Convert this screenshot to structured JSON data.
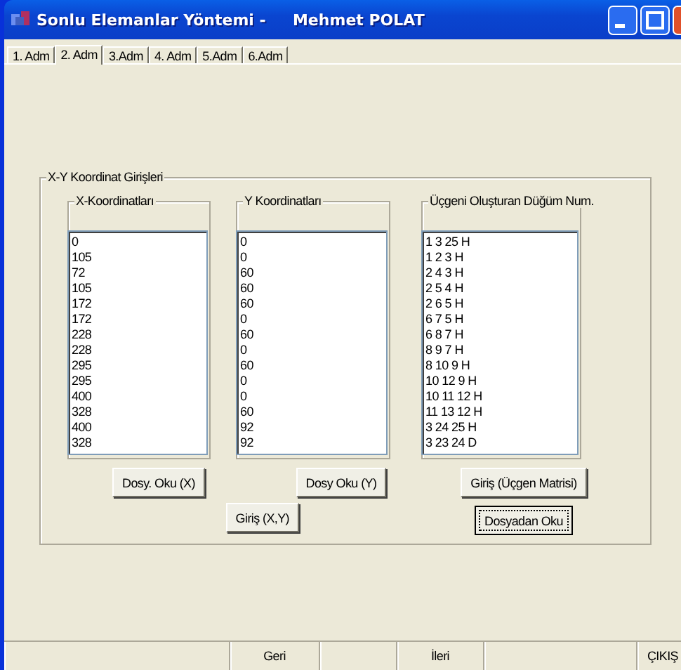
{
  "window": {
    "title": "Sonlu Elemanlar Yöntemi -     Mehmet POLAT"
  },
  "tabs": [
    {
      "label": "1. Adm",
      "selected": false
    },
    {
      "label": "2. Adm",
      "selected": true
    },
    {
      "label": "3.Adm",
      "selected": false
    },
    {
      "label": "4. Adm",
      "selected": false
    },
    {
      "label": "5.Adm",
      "selected": false
    },
    {
      "label": "6.Adm",
      "selected": false
    }
  ],
  "group": {
    "title": "X-Y Koordinat Girişleri",
    "lists": [
      {
        "title": "X-Koordinatları",
        "items": [
          "0",
          "105",
          "72",
          "105",
          "172",
          "172",
          "228",
          "228",
          "295",
          "295",
          "400",
          "328",
          "400",
          "328"
        ]
      },
      {
        "title": "Y Koordinatları",
        "items": [
          "0",
          "0",
          "60",
          "60",
          "60",
          "0",
          "60",
          "0",
          "60",
          "0",
          "0",
          "60",
          "92",
          "92"
        ]
      },
      {
        "title": "Üçgeni Oluşturan Düğüm Num.",
        "items": [
          "1 3 25 H",
          "1 2 3 H",
          "2 4 3 H",
          "2 5 4 H",
          "2 6 5 H",
          "6 7 5 H",
          "6 8 7 H",
          "8 9 7 H",
          "8 10 9 H",
          "10 12 9 H",
          "10 11 12 H",
          "11 13 12 H",
          "3 24 25 H",
          "3 23 24 D"
        ]
      }
    ],
    "buttons": [
      {
        "label": "Dosy. Oku (X)",
        "focused": false
      },
      {
        "label": "Dosy Oku (Y)",
        "focused": false
      },
      {
        "label": "Giriş (Üçgen Matrisi)",
        "focused": false
      },
      {
        "label": "Giriş (X,Y)",
        "focused": false
      },
      {
        "label": "Dosyadan Oku",
        "focused": true
      }
    ]
  },
  "status_bar": [
    {
      "kind": "blank"
    },
    {
      "kind": "button",
      "label": "Geri"
    },
    {
      "kind": "blank"
    },
    {
      "kind": "button",
      "label": "İleri"
    },
    {
      "kind": "blank"
    },
    {
      "kind": "button",
      "label": "ÇIKIŞ"
    }
  ]
}
